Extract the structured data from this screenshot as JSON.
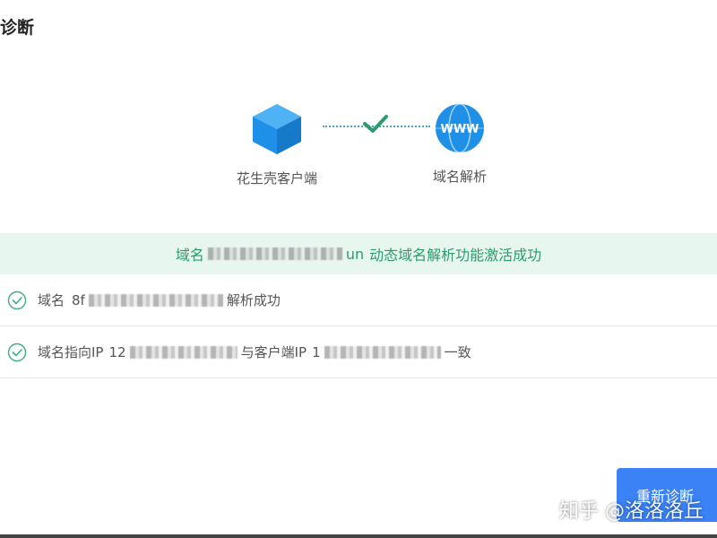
{
  "dialog": {
    "title": "诊断"
  },
  "flow": {
    "client_label": "花生壳客户端",
    "dns_label": "域名解析",
    "dns_icon_text": "WWW"
  },
  "banner": {
    "prefix": "域名",
    "visible_fragment": "un",
    "suffix": "动态域名解析功能激活成功"
  },
  "checks": [
    {
      "prefix": "域名",
      "visible_fragment": "8f",
      "suffix": "解析成功"
    },
    {
      "prefix": "域名指向IP",
      "visible_fragment": "12",
      "middle": "与客户端IP",
      "visible_fragment2": "1",
      "suffix": "一致"
    }
  ],
  "actions": {
    "retry_label": "重新诊断"
  },
  "watermark": "知乎 @洛洛洛丘",
  "colors": {
    "primary": "#3b82f6",
    "success": "#2e9a6e",
    "success_bg": "#e8f6f0",
    "icon_blue": "#1e90e8"
  }
}
